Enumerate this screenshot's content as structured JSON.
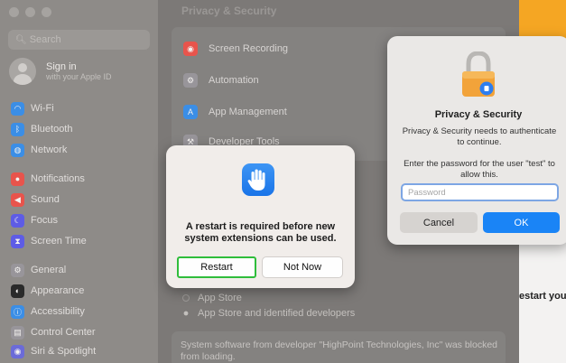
{
  "sidebar": {
    "search_placeholder": "Search",
    "signin_title": "Sign in",
    "signin_subtitle": "with your Apple ID",
    "items": [
      {
        "label": "Wi-Fi",
        "icon": "wifi-icon",
        "color": "#3b8ee6"
      },
      {
        "label": "Bluetooth",
        "icon": "bluetooth-icon",
        "color": "#3b8ee6"
      },
      {
        "label": "Network",
        "icon": "globe-icon",
        "color": "#3b8ee6"
      },
      {
        "label": "Notifications",
        "icon": "bell-icon",
        "color": "#e8544c"
      },
      {
        "label": "Sound",
        "icon": "speaker-icon",
        "color": "#e8544c"
      },
      {
        "label": "Focus",
        "icon": "moon-icon",
        "color": "#5e5ce6"
      },
      {
        "label": "Screen Time",
        "icon": "hourglass-icon",
        "color": "#5e5ce6"
      },
      {
        "label": "General",
        "icon": "gear-icon",
        "color": "#98959a"
      },
      {
        "label": "Appearance",
        "icon": "appearance-icon",
        "color": "#2a2a2a"
      },
      {
        "label": "Accessibility",
        "icon": "accessibility-icon",
        "color": "#3b8ee6"
      },
      {
        "label": "Control Center",
        "icon": "control-center-icon",
        "color": "#98959a"
      },
      {
        "label": "Siri & Spotlight",
        "icon": "siri-icon",
        "color": "#6b6bd8"
      }
    ]
  },
  "main": {
    "title": "Privacy & Security",
    "rows": [
      {
        "label": "Screen Recording",
        "icon": "screen-recording-icon",
        "color": "#e8544c"
      },
      {
        "label": "Automation",
        "icon": "automation-icon",
        "color": "#98959a"
      },
      {
        "label": "App Management",
        "icon": "app-store-icon",
        "color": "#3b8ee6"
      },
      {
        "label": "Developer Tools",
        "icon": "hammer-icon",
        "color": "#98959a"
      }
    ],
    "radio_app_store": "App Store",
    "radio_identified": "App Store and identified developers",
    "blocked_message": "System software from developer \"HighPoint Technologies, Inc\" was blocked from loading."
  },
  "background_fragment": "estart you",
  "alert": {
    "message": "A restart is required before new system extensions can be used.",
    "restart_label": "Restart",
    "not_now_label": "Not Now"
  },
  "auth": {
    "title": "Privacy & Security",
    "description": "Privacy & Security needs to authenticate to continue.",
    "prompt": "Enter the password for the user \"test\" to allow this.",
    "password_placeholder": "Password",
    "cancel_label": "Cancel",
    "ok_label": "OK"
  },
  "colors": {
    "accent": "#1a84f6",
    "restart_highlight": "#2fbd3b"
  }
}
